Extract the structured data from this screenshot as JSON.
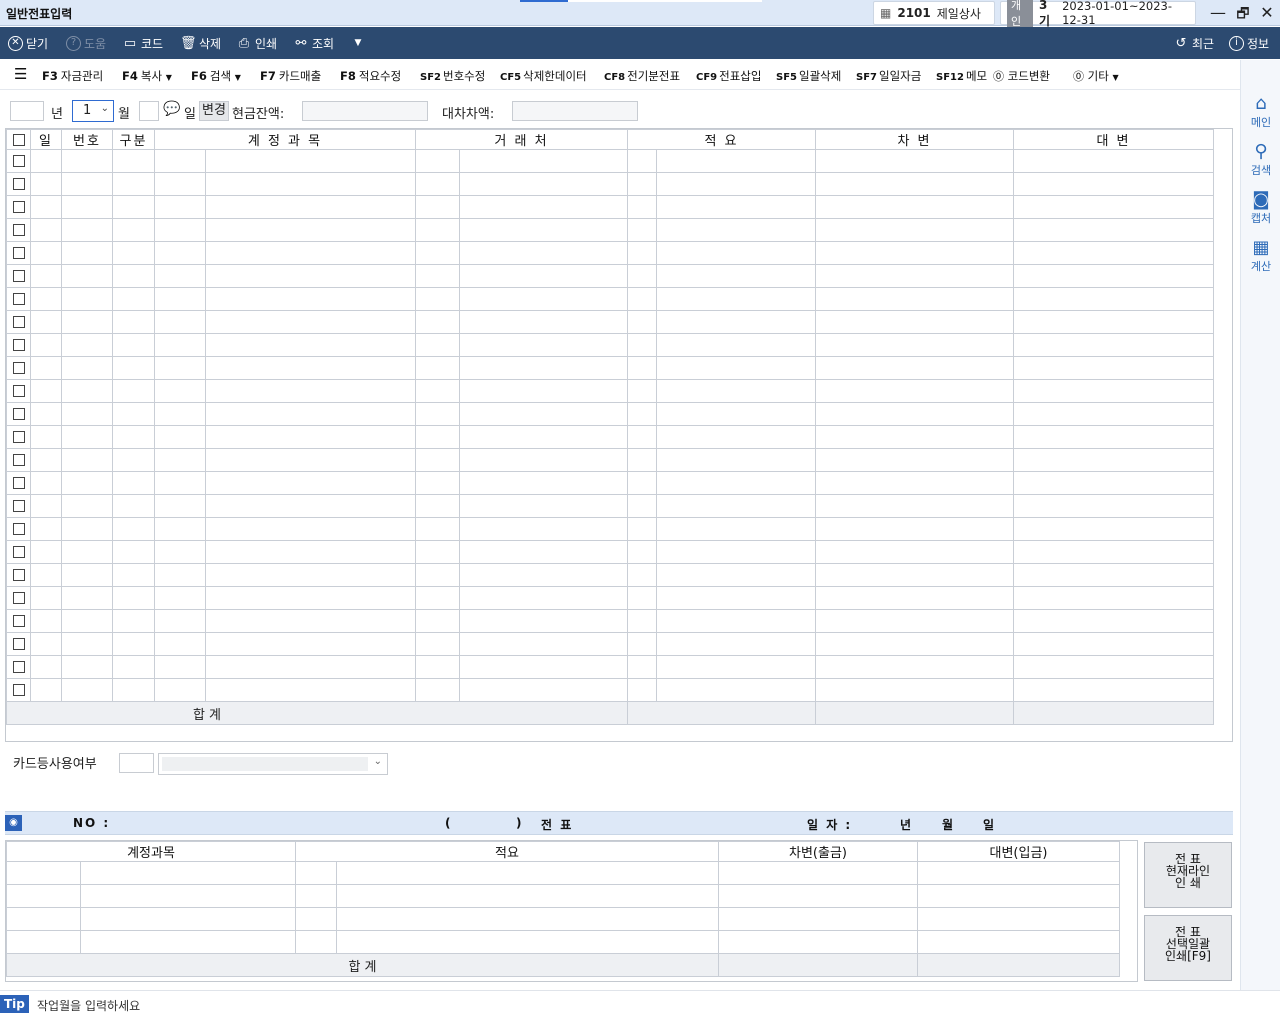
{
  "window": {
    "title": "일반전표입력",
    "minimize": "—",
    "restore": "🗗",
    "close": "✕"
  },
  "company": {
    "code": "2101",
    "name": "제일상사"
  },
  "period": {
    "badge": "개인",
    "term": "3기",
    "range": "2023-01-01~2023-12-31"
  },
  "toolbar": {
    "close": "닫기",
    "help": "도움",
    "code": "코드",
    "delete": "삭제",
    "print": "인쇄",
    "search": "조회",
    "recent": "최근",
    "info": "정보"
  },
  "fkeys": [
    {
      "key": "F3",
      "label": "자금관리"
    },
    {
      "key": "F4",
      "label": "복사"
    },
    {
      "key": "F6",
      "label": "검색"
    },
    {
      "key": "F7",
      "label": "카드매출"
    },
    {
      "key": "F8",
      "label": "적요수정"
    },
    {
      "key": "SF2",
      "label": "번호수정"
    },
    {
      "key": "CF5",
      "label": "삭제한데이터"
    },
    {
      "key": "CF8",
      "label": "전기분전표"
    },
    {
      "key": "CF9",
      "label": "전표삽입"
    },
    {
      "key": "SF5",
      "label": "일괄삭제"
    },
    {
      "key": "SF7",
      "label": "일일자금"
    },
    {
      "key": "SF12",
      "label": "메모"
    },
    {
      "key": "",
      "label": "코드변환"
    },
    {
      "key": "",
      "label": "기타"
    }
  ],
  "sidebar": {
    "home": "메인",
    "search": "검색",
    "capture": "캡처",
    "calc": "계산"
  },
  "filter": {
    "year_label": "년",
    "month_value": "1",
    "month_label": "월",
    "day_label": "일",
    "change_btn": "변경",
    "cash_label": "현금잔액:",
    "diff_label": "대차차액:"
  },
  "grid": {
    "headers": [
      "일",
      "번호",
      "구분",
      "계 정 과 목",
      "거 래 처",
      "적 요",
      "차 변",
      "대 변"
    ],
    "sum_label": "합          계"
  },
  "card": {
    "label": "카드등사용여부"
  },
  "voucher": {
    "no_label": "NO :",
    "type_open": "(",
    "type_close": ")",
    "type_label": "전   표",
    "date_label": "일 자 :",
    "year": "년",
    "month": "월",
    "day": "일",
    "headers": [
      "계정과목",
      "적요",
      "차변(출금)",
      "대변(입금)"
    ],
    "sum_label": "합                        계",
    "btn_print_current": [
      "전      표",
      "현재라인",
      "인      쇄"
    ],
    "btn_print_batch": [
      "전      표",
      "선택일괄",
      "인쇄[F9]"
    ]
  },
  "tip": {
    "tag": "Tip",
    "text": "작업월을 입력하세요"
  }
}
